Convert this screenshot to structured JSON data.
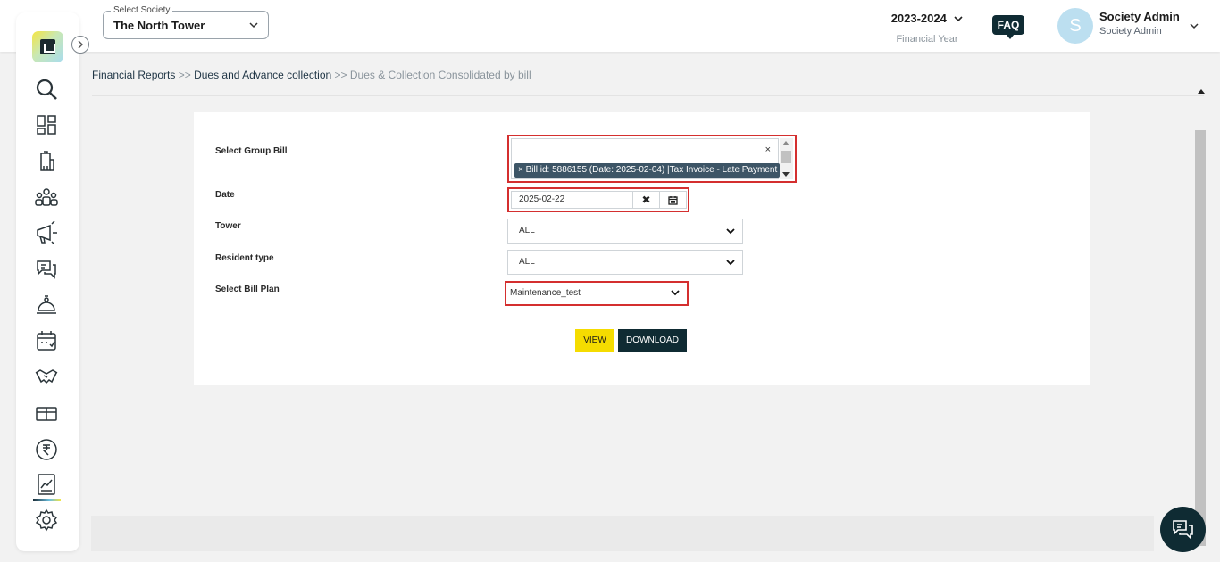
{
  "header": {
    "society_legend": "Select Society",
    "society_value": "The North Tower",
    "financial_year": "2023-2024",
    "financial_year_label": "Financial Year",
    "faq_label": "FAQ",
    "avatar_initial": "S",
    "user_name": "Society Admin",
    "user_role": "Society Admin"
  },
  "sidebar": {
    "items": [
      {
        "icon": "search-icon"
      },
      {
        "icon": "dashboard-icon"
      },
      {
        "icon": "building-icon"
      },
      {
        "icon": "people-icon"
      },
      {
        "icon": "megaphone-icon"
      },
      {
        "icon": "chat-bubbles-icon"
      },
      {
        "icon": "service-bell-icon"
      },
      {
        "icon": "calendar-icon"
      },
      {
        "icon": "handshake-icon"
      },
      {
        "icon": "gift-icon"
      },
      {
        "icon": "rupee-icon"
      },
      {
        "icon": "reports-chart-icon",
        "active": true
      },
      {
        "icon": "gear-icon"
      }
    ]
  },
  "breadcrumb": {
    "item1": "Financial Reports",
    "sep1": " >> ",
    "item2": "Dues and Advance collection",
    "sep2": " >> ",
    "current": "Dues & Collection Consolidated by bill"
  },
  "form": {
    "group_bill_label": "Select Group Bill",
    "group_bill_clear": "×",
    "group_bill_tag": "× Bill id: 5886155 (Date: 2025-02-04) |Tax Invoice - Late Payment",
    "date_label": "Date",
    "date_value": "2025-02-22",
    "tower_label": "Tower",
    "tower_value": "ALL",
    "resident_type_label": "Resident type",
    "resident_type_value": "ALL",
    "bill_plan_label": "Select Bill Plan",
    "bill_plan_value": "Maintenance_test",
    "view_button": "VIEW",
    "download_button": "DOWNLOAD"
  },
  "colors": {
    "highlight_border": "#d42f2f",
    "primary_dark": "#0f2b33",
    "accent_yellow": "#f5dc00",
    "tag_bg": "#3d5566"
  }
}
